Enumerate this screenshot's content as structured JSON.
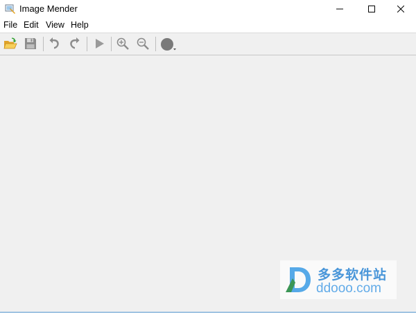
{
  "window": {
    "title": "Image Mender",
    "minimize_label": "Minimize",
    "maximize_label": "Maximize",
    "close_label": "Close"
  },
  "menu": {
    "items": [
      {
        "label": "File"
      },
      {
        "label": "Edit"
      },
      {
        "label": "View"
      },
      {
        "label": "Help"
      }
    ]
  },
  "toolbar": {
    "buttons": [
      {
        "icon": "open-folder-icon",
        "enabled": true
      },
      {
        "icon": "save-icon",
        "enabled": false
      },
      {
        "icon": "undo-icon",
        "enabled": false
      },
      {
        "icon": "redo-icon",
        "enabled": false
      },
      {
        "icon": "run-icon",
        "enabled": false
      },
      {
        "icon": "zoom-in-icon",
        "enabled": false
      },
      {
        "icon": "zoom-out-icon",
        "enabled": false
      },
      {
        "icon": "brush-size-icon",
        "enabled": true
      }
    ]
  },
  "watermark": {
    "cn_text": "多多软件站",
    "url_text": "ddooo.com"
  },
  "colors": {
    "background": "#f0f0f0",
    "disabled_icon": "#8c8c8c",
    "folder": "#f2c042",
    "arrow_green": "#3aa53a",
    "watermark_blue": "#3b8fd8"
  }
}
